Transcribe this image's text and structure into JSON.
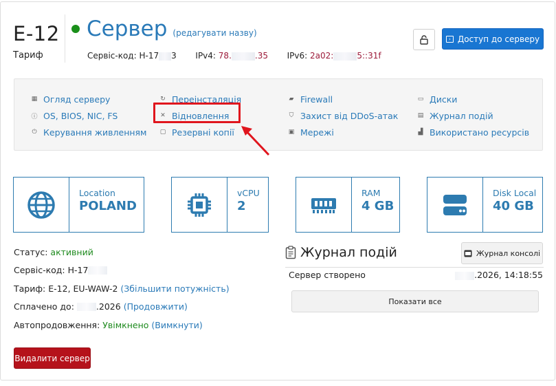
{
  "header": {
    "tariff_name": "E-12",
    "tariff_label": "Тариф",
    "server_title": "Сервер",
    "rename_link": "(редагувати назву)",
    "service_code_label": "Сервіс-код:",
    "service_code_start": "H-17",
    "service_code_end": "3",
    "ipv4_label": "IPv4:",
    "ipv4_start": "78.",
    "ipv4_end": ".35",
    "ipv6_label": "IPv6:",
    "ipv6_start": "2a02:",
    "ipv6_end": "5::31f",
    "access_button": "Доступ до серверу"
  },
  "nav": {
    "col1": [
      {
        "icon": "overview-icon",
        "label": "Огляд серверу"
      },
      {
        "icon": "info-icon",
        "label": "OS, BIOS, NIC, FS"
      },
      {
        "icon": "power-icon",
        "label": "Керування живленням"
      }
    ],
    "col2": [
      {
        "icon": "reinstall-icon",
        "label": "Переінсталяція"
      },
      {
        "icon": "tools-icon",
        "label": "Відновлення"
      },
      {
        "icon": "backup-icon",
        "label": "Резервні копії"
      }
    ],
    "col3": [
      {
        "icon": "firewall-icon",
        "label": "Firewall"
      },
      {
        "icon": "shield-icon",
        "label": "Захист від DDoS-атак"
      },
      {
        "icon": "network-icon",
        "label": "Мережі"
      }
    ],
    "col4": [
      {
        "icon": "disk-icon",
        "label": "Диски"
      },
      {
        "icon": "log-icon",
        "label": "Журнал подій"
      },
      {
        "icon": "chart-icon",
        "label": "Використано ресурсів"
      }
    ]
  },
  "stats": {
    "location": {
      "label": "Location",
      "value": "POLAND"
    },
    "vcpu": {
      "label": "vCPU",
      "value": "2"
    },
    "ram": {
      "label": "RAM",
      "value": "4 GB"
    },
    "disk": {
      "label": "Disk Local",
      "value": "40 GB"
    }
  },
  "info": {
    "status_label": "Статус:",
    "status_value": "активний",
    "service_code_label": "Сервіс-код:",
    "service_code_value": "H-17",
    "tariff_label": "Тариф:",
    "tariff_value": "E-12, EU-WAW-2",
    "upgrade_link": "(Збільшити потужність)",
    "paid_label": "Сплачено до:",
    "paid_value": ".2026",
    "extend_link": "(Продовжити)",
    "autorenew_label": "Автопродовження:",
    "autorenew_value": "Увімкнено",
    "disable_link": "(Вимкнути)",
    "delete_button": "Видалити сервер"
  },
  "log": {
    "title": "Журнал подій",
    "console_button": "Журнал консолі",
    "entry_text": "Сервер створено",
    "entry_time": ".2026, 14:18:55",
    "show_all_button": "Показати все"
  },
  "colors": {
    "accent": "#2a7ab8",
    "primary_button": "#1976d2",
    "danger_button": "#b5121b",
    "status_green": "#1e8a1e",
    "highlight_red": "#e0151d",
    "ip_value": "#9c1b3a"
  }
}
